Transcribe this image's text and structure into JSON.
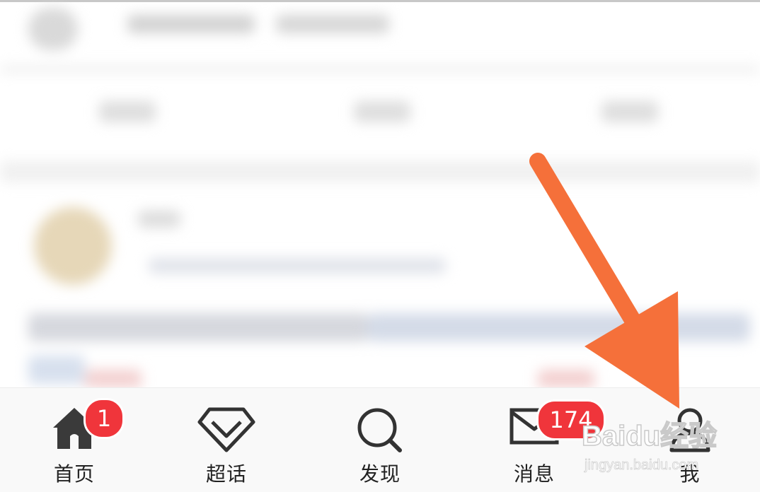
{
  "tabs": [
    {
      "key": "home",
      "label": "首页",
      "icon": "home-icon",
      "badge": "1"
    },
    {
      "key": "super",
      "label": "超话",
      "icon": "diamond-icon",
      "badge": ""
    },
    {
      "key": "discover",
      "label": "发现",
      "icon": "search-icon",
      "badge": ""
    },
    {
      "key": "messages",
      "label": "消息",
      "icon": "envelope-icon",
      "badge": "174"
    },
    {
      "key": "me",
      "label": "我",
      "icon": "person-icon",
      "badge": ""
    }
  ],
  "watermark": {
    "brand": "Baidu经验",
    "url": "jingyan.baidu.com"
  },
  "colors": {
    "badge": "#f0353b",
    "arrow": "#f5703a",
    "label": "#222222"
  }
}
